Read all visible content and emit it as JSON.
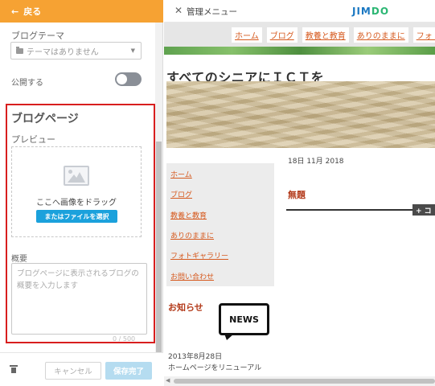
{
  "panel": {
    "back_label": "戻る",
    "blog_theme_label": "ブログテーマ",
    "theme_select_value": "テーマはありません",
    "publish_label": "公開する",
    "publish_enabled": false,
    "section_title": "ブログページ",
    "preview_label": "プレビュー",
    "drag_text": "ここへ画像をドラッグ",
    "select_file_label": "またはファイルを選択",
    "summary_label": "概要",
    "summary_placeholder": "ブログページに表示されるブログの概要を入力します",
    "char_count": "0 / 500",
    "cancel_label": "キャンセル",
    "save_label": "保存完了"
  },
  "topbar": {
    "close_symbol": "✕",
    "admin_menu_label": "管理メニュー",
    "logo_part1": "JIM",
    "logo_part2": "DO"
  },
  "site": {
    "nav": [
      "ホーム",
      "ブログ",
      "教養と教育",
      "ありのままに",
      "フォト"
    ],
    "title": "すべてのシニアにＩＣＴを",
    "date": "18日 11月 2018",
    "sidebar_links": [
      "ホーム",
      "ブログ",
      "教養と教育",
      "ありのままに",
      "フォトギャラリー",
      "お問い合わせ"
    ],
    "post_title": "無題",
    "add_label": "+ コ",
    "news_heading": "お知らせ",
    "news_badge": "NEWS",
    "news_date": "2013年8月28日",
    "news_text": "ホームページをリニューアル"
  },
  "colors": {
    "back_bar": "#f6a233",
    "highlight_border": "#d81e1e",
    "primary_button": "#1ba1dc",
    "save_button_disabled": "#b5dcf0",
    "link": "#d65a1f"
  }
}
